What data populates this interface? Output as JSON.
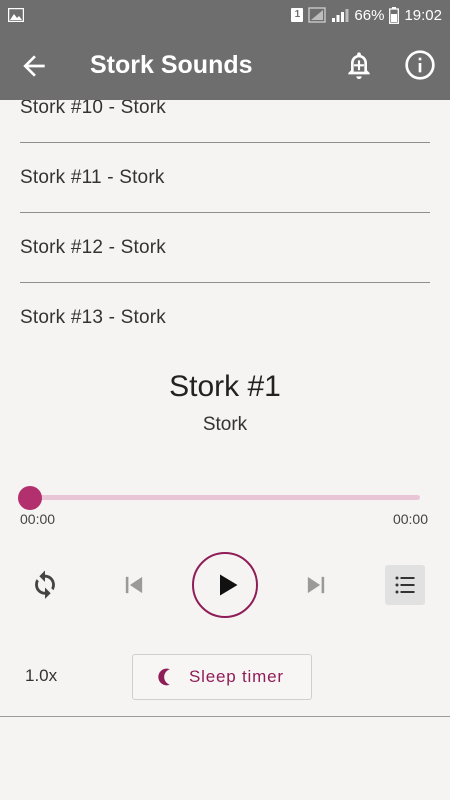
{
  "status_bar": {
    "sim_badge": "1",
    "battery_percent": "66%",
    "time": "19:02"
  },
  "app_bar": {
    "title": "Stork Sounds",
    "icons": [
      "back-arrow-icon",
      "alarm-add-icon",
      "info-icon"
    ]
  },
  "list": {
    "items": [
      "Stork #10 - Stork",
      "Stork #11 - Stork",
      "Stork #12 - Stork",
      "Stork #13 - Stork"
    ]
  },
  "now_playing": {
    "title": "Stork #1",
    "subtitle": "Stork",
    "elapsed": "00:00",
    "duration": "00:00",
    "progress": 0
  },
  "controls": {
    "speed": "1.0x",
    "sleep_timer_label": "Sleep timer"
  },
  "colors": {
    "accent": "#8f1d57",
    "seek_thumb": "#b2306d",
    "seek_track": "#e9c6d6",
    "app_bar": "#6e6e6e",
    "background": "#f5f4f2"
  }
}
